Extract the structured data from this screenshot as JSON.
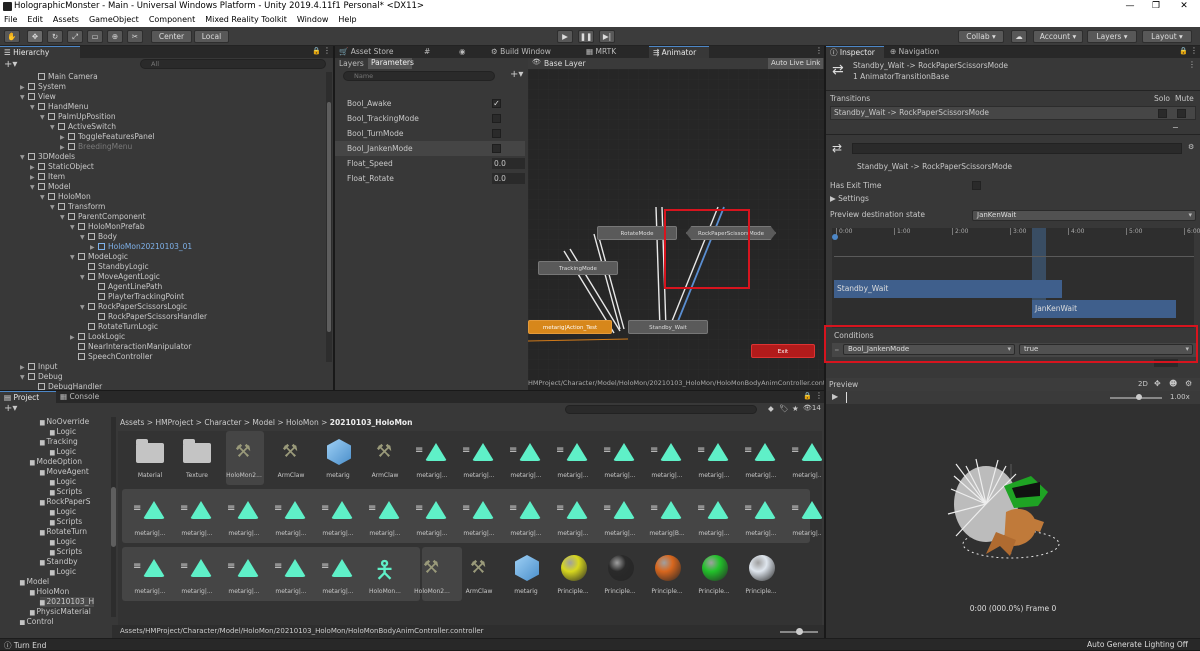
{
  "window": {
    "title": "HolographicMonster - Main - Universal Windows Platform - Unity 2019.4.11f1 Personal* <DX11>"
  },
  "menu": [
    "File",
    "Edit",
    "Assets",
    "GameObject",
    "Component",
    "Mixed Reality Toolkit",
    "Window",
    "Help"
  ],
  "toolbar": {
    "center": "Center",
    "local": "Local",
    "collab": "Collab",
    "account": "Account",
    "layers": "Layers",
    "layout": "Layout"
  },
  "hierarchy": {
    "tab": "Hierarchy",
    "search_placeholder": "All",
    "items": [
      {
        "label": "Main Camera",
        "indent": 1,
        "arrow": ""
      },
      {
        "label": "System",
        "indent": 0,
        "arrow": "▶"
      },
      {
        "label": "View",
        "indent": 0,
        "arrow": "▼"
      },
      {
        "label": "HandMenu",
        "indent": 1,
        "arrow": "▼"
      },
      {
        "label": "PalmUpPosition",
        "indent": 2,
        "arrow": "▼"
      },
      {
        "label": "ActiveSwitch",
        "indent": 3,
        "arrow": "▼"
      },
      {
        "label": "ToggleFeaturesPanel",
        "indent": 4,
        "arrow": "▶"
      },
      {
        "label": "BreedingMenu",
        "indent": 4,
        "arrow": "▶",
        "dim": true
      },
      {
        "label": "3DModels",
        "indent": 0,
        "arrow": "▼"
      },
      {
        "label": "StaticObject",
        "indent": 1,
        "arrow": "▶"
      },
      {
        "label": "Item",
        "indent": 1,
        "arrow": "▶"
      },
      {
        "label": "Model",
        "indent": 1,
        "arrow": "▼"
      },
      {
        "label": "HoloMon",
        "indent": 2,
        "arrow": "▼"
      },
      {
        "label": "Transform",
        "indent": 3,
        "arrow": "▼"
      },
      {
        "label": "ParentComponent",
        "indent": 4,
        "arrow": "▼"
      },
      {
        "label": "HoloMonPrefab",
        "indent": 5,
        "arrow": "▼"
      },
      {
        "label": "Body",
        "indent": 6,
        "arrow": "▼"
      },
      {
        "label": "HoloMon20210103_01",
        "indent": 7,
        "arrow": "▶",
        "blue": true
      },
      {
        "label": "ModeLogic",
        "indent": 5,
        "arrow": "▼"
      },
      {
        "label": "StandbyLogic",
        "indent": 6,
        "arrow": ""
      },
      {
        "label": "MoveAgentLogic",
        "indent": 6,
        "arrow": "▼"
      },
      {
        "label": "AgentLinePath",
        "indent": 7,
        "arrow": ""
      },
      {
        "label": "PlayterTrackingPoint",
        "indent": 7,
        "arrow": ""
      },
      {
        "label": "RockPaperScissorsLogic",
        "indent": 6,
        "arrow": "▼"
      },
      {
        "label": "RockPaperScissorsHandler",
        "indent": 7,
        "arrow": ""
      },
      {
        "label": "RotateTurnLogic",
        "indent": 6,
        "arrow": ""
      },
      {
        "label": "LookLogic",
        "indent": 5,
        "arrow": "▶"
      },
      {
        "label": "NearInteractionManipulator",
        "indent": 5,
        "arrow": ""
      },
      {
        "label": "SpeechController",
        "indent": 5,
        "arrow": ""
      },
      {
        "label": "Input",
        "indent": 0,
        "arrow": "▶"
      },
      {
        "label": "Debug",
        "indent": 0,
        "arrow": "▼"
      },
      {
        "label": "DebugHandler",
        "indent": 1,
        "arrow": ""
      }
    ]
  },
  "center_tabs": [
    "Asset Store",
    "Scene",
    "Game",
    "Build Window",
    "MRTK Toolbox",
    "Animator"
  ],
  "animator": {
    "subtabs": [
      "Layers",
      "Parameters"
    ],
    "search_placeholder": "Name",
    "breadcrumb": "Base Layer",
    "auto_live_link": "Auto Live Link",
    "parameters": [
      {
        "name": "Bool_Awake",
        "type": "bool",
        "checked": true
      },
      {
        "name": "Bool_TrackingMode",
        "type": "bool",
        "checked": false
      },
      {
        "name": "Bool_TurnMode",
        "type": "bool",
        "checked": false
      },
      {
        "name": "Bool_JankenMode",
        "type": "bool",
        "checked": false
      },
      {
        "name": "Float_Speed",
        "type": "float",
        "value": "0.0"
      },
      {
        "name": "Float_Rotate",
        "type": "float",
        "value": "0.0"
      }
    ],
    "states": {
      "rotate": "RotateMode",
      "rps": "RockPaperScissorsMode",
      "tracking": "TrackingMode",
      "standby": "Standby_Wait",
      "action": "metarig|Action_Test",
      "exit": "Exit"
    },
    "footer_path": "HMProject/Character/Model/HoloMon/20210103_HoloMon/HoloMonBodyAnimController.controller"
  },
  "inspector": {
    "tabs": [
      "Inspector",
      "Navigation"
    ],
    "header_title": "Standby_Wait -> RockPaperScissorsMode",
    "header_sub": "1 AnimatorTransitionBase",
    "transitions_label": "Transitions",
    "solo": "Solo",
    "mute": "Mute",
    "transition_item": "Standby_Wait -> RockPaperScissorsMode",
    "transition_name": "Standby_Wait -> RockPaperScissorsMode",
    "has_exit_time": "Has Exit Time",
    "settings": "Settings",
    "preview_dest": "Preview destination state",
    "preview_dest_value": "JanKenWait",
    "timeline_ticks": [
      "0:00",
      "1:00",
      "2:00",
      "3:00",
      "4:00",
      "5:00",
      "6:00"
    ],
    "bar1": "Standby_Wait",
    "bar2": "JanKenWait",
    "conditions_label": "Conditions",
    "condition_param": "Bool_JankenMode",
    "condition_value": "true",
    "preview_label": "Preview",
    "preview_2d": "2D",
    "preview_speed": "1.00x",
    "preview_frame": "0:00 (000.0%) Frame 0"
  },
  "project": {
    "tabs": [
      "Project",
      "Console"
    ],
    "breadcrumb": [
      "Assets",
      "HMProject",
      "Character",
      "Model",
      "HoloMon",
      "20210103_HoloMon"
    ],
    "count": "14",
    "tree": [
      {
        "label": "NoOverride",
        "indent": 2
      },
      {
        "label": "Logic",
        "indent": 3
      },
      {
        "label": "Tracking",
        "indent": 2
      },
      {
        "label": "Logic",
        "indent": 3
      },
      {
        "label": "ModeOption",
        "indent": 1
      },
      {
        "label": "MoveAgent",
        "indent": 2
      },
      {
        "label": "Logic",
        "indent": 3
      },
      {
        "label": "Scripts",
        "indent": 3
      },
      {
        "label": "RockPaperS",
        "indent": 2
      },
      {
        "label": "Logic",
        "indent": 3
      },
      {
        "label": "Scripts",
        "indent": 3
      },
      {
        "label": "RotateTurn",
        "indent": 2
      },
      {
        "label": "Logic",
        "indent": 3
      },
      {
        "label": "Scripts",
        "indent": 3
      },
      {
        "label": "Standby",
        "indent": 2
      },
      {
        "label": "Logic",
        "indent": 3
      },
      {
        "label": "Model",
        "indent": 0
      },
      {
        "label": "HoloMon",
        "indent": 1
      },
      {
        "label": "20210103_H",
        "indent": 2
      },
      {
        "label": "PhysicMaterial",
        "indent": 1
      },
      {
        "label": "Control",
        "indent": 0
      },
      {
        "label": "Debug",
        "indent": 0
      }
    ],
    "row1": [
      {
        "label": "Material",
        "kind": "folder"
      },
      {
        "label": "Texture",
        "kind": "folder"
      },
      {
        "label": "HoloMon2...",
        "kind": "model"
      },
      {
        "label": "ArmClaw",
        "kind": "model"
      },
      {
        "label": "metarig",
        "kind": "mesh"
      },
      {
        "label": "ArmClaw",
        "kind": "model"
      },
      {
        "label": "metarig|...",
        "kind": "anim"
      },
      {
        "label": "metarig|...",
        "kind": "anim"
      },
      {
        "label": "metarig|...",
        "kind": "anim"
      },
      {
        "label": "metarig|...",
        "kind": "anim"
      },
      {
        "label": "metarig|...",
        "kind": "anim"
      },
      {
        "label": "metarig|...",
        "kind": "anim"
      },
      {
        "label": "metarig|...",
        "kind": "anim"
      },
      {
        "label": "metarig|...",
        "kind": "anim"
      },
      {
        "label": "metarig|...",
        "kind": "anim"
      }
    ],
    "row2": [
      "metarig|...",
      "metarig|...",
      "metarig|...",
      "metarig|...",
      "metarig|...",
      "metarig|...",
      "metarig|...",
      "metarig|...",
      "metarig|...",
      "metarig|...",
      "metarig|...",
      "metarig|B...",
      "metarig|...",
      "metarig|...",
      "metarig|..."
    ],
    "row3": [
      {
        "label": "metarig|...",
        "kind": "anim"
      },
      {
        "label": "metarig|...",
        "kind": "anim"
      },
      {
        "label": "metarig|...",
        "kind": "anim"
      },
      {
        "label": "metarig|...",
        "kind": "anim"
      },
      {
        "label": "metarig|...",
        "kind": "anim"
      },
      {
        "label": "HoloMon...",
        "kind": "avatar"
      },
      {
        "label": "HoloMon2...",
        "kind": "model"
      },
      {
        "label": "ArmClaw",
        "kind": "model"
      },
      {
        "label": "metarig",
        "kind": "mesh"
      },
      {
        "label": "Principle...",
        "kind": "ball",
        "color": "#d8d81e"
      },
      {
        "label": "Principle...",
        "kind": "ball",
        "color": "#2a2a2a"
      },
      {
        "label": "Principle...",
        "kind": "ball",
        "color": "#d8671e"
      },
      {
        "label": "Principle...",
        "kind": "ball",
        "color": "#22c22a"
      },
      {
        "label": "Principle...",
        "kind": "ball",
        "color": "#dfe6ee"
      }
    ],
    "footer_path": "Assets/HMProject/Character/Model/HoloMon/20210103_HoloMon/HoloMonBodyAnimController.controller"
  },
  "status": {
    "left": "Turn End",
    "right": "Auto Generate Lighting Off"
  }
}
